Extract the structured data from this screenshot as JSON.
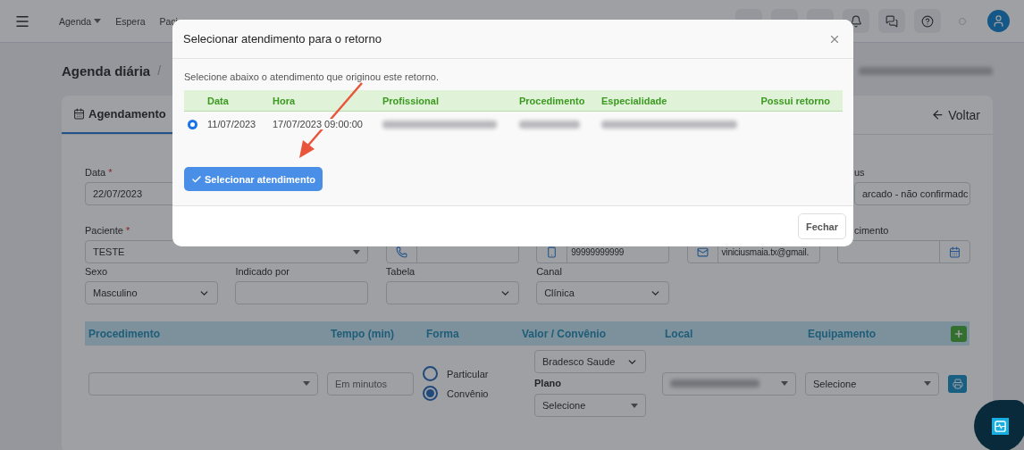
{
  "navbar": {
    "menu": [
      {
        "label": "Agenda",
        "dropdown": true
      },
      {
        "label": "Espera",
        "dropdown": false
      },
      {
        "label": "Paci",
        "dropdown": false
      }
    ]
  },
  "page": {
    "title": "Agenda diária",
    "separator": "/"
  },
  "card": {
    "tabs": [
      {
        "label": "Agendamento",
        "selected": true
      }
    ],
    "back_link": "Voltar"
  },
  "form": {
    "rows": [
      [
        {
          "kind": "input",
          "label": "Data",
          "mark": "*",
          "value": "22/07/2023"
        },
        "",
        "",
        "",
        {
          "kind": "select",
          "label": "us",
          "value": "arcado - não confirmadc"
        }
      ],
      [
        {
          "kind": "combobox",
          "label": "Paciente",
          "mark": "*",
          "value": "TESTE"
        },
        {
          "kind": "icon_input"
        },
        {
          "kind": "icon_input",
          "value": "99999999999"
        },
        {
          "kind": "icon_input",
          "value": "viniciusmaia.tx@gmail."
        },
        {
          "kind": "date_input",
          "label": "cimento"
        }
      ],
      [
        {
          "kind": "select",
          "label": "Sexo",
          "value": "Masculino"
        },
        {
          "kind": "input",
          "label": "Indicado por"
        },
        {
          "kind": "select",
          "label": "Tabela"
        },
        {
          "kind": "select",
          "label": "Canal",
          "value": "Clínica"
        }
      ]
    ]
  },
  "procedures": {
    "columns": [
      "Procedimento",
      "Tempo (min)",
      "Forma",
      "Valor / Convênio",
      "Local",
      "Equipamento"
    ],
    "row": {
      "procedimento": {
        "kind": "combobox"
      },
      "tempo": {
        "placeholder": "Em minutos"
      },
      "forma": [
        {
          "label": "Particular",
          "selected": false
        },
        {
          "label": "Convênio",
          "selected": true
        }
      ],
      "valor": {
        "kind": "select",
        "value": "Bradesco Saude"
      },
      "plano_label": "Plano",
      "plano": {
        "kind": "combobox",
        "value": "Selecione"
      },
      "local": {
        "kind": "combobox",
        "blurred": true
      },
      "equipamento": {
        "kind": "combobox",
        "value": "Selecione"
      }
    }
  },
  "modal": {
    "title": "Selecionar atendimento para o retorno",
    "instruction": "Selecione abaixo o atendimento que originou este retorno.",
    "columns": [
      "Data",
      "Hora",
      "Profissional",
      "Procedimento",
      "Especialidade",
      "Possui retorno"
    ],
    "rows": [
      {
        "selected": true,
        "data": "11/07/2023",
        "hora": "17/07/2023 09:00:00"
      }
    ],
    "select_button": "Selecionar atendimento",
    "close_button": "Fechar"
  }
}
